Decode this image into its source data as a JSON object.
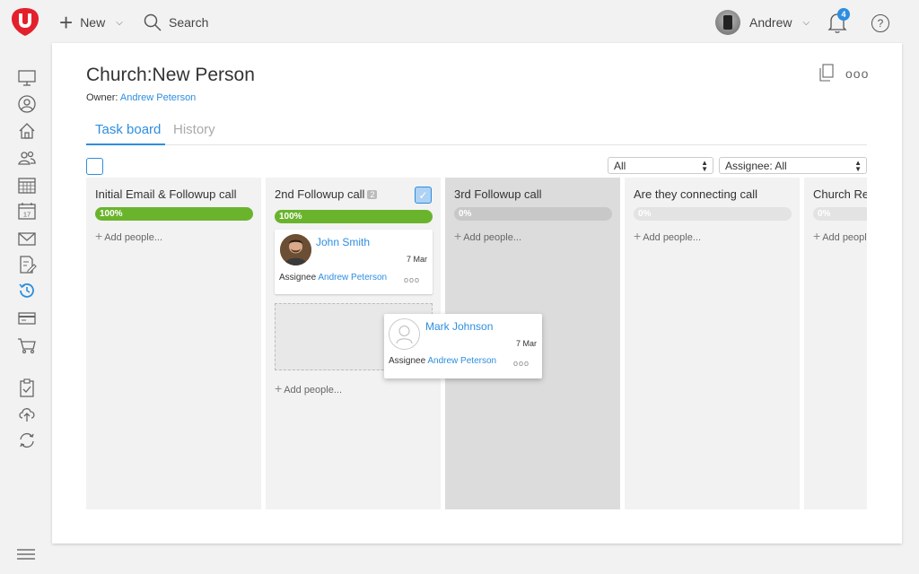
{
  "topbar": {
    "new_label": "New",
    "search_label": "Search",
    "user_name": "Andrew",
    "notification_count": "4",
    "help_label": "?"
  },
  "sidebar": {
    "icons": [
      "monitor-icon",
      "user-circle-icon",
      "home-icon",
      "people-icon",
      "calendar-grid-icon",
      "calendar-day-icon",
      "mail-icon",
      "form-icon",
      "history-icon",
      "credit-card-icon",
      "cart-icon",
      "clipboard-icon",
      "upload-cloud-icon",
      "sync-icon"
    ],
    "calendar_day": "17"
  },
  "page": {
    "title": "Church:New Person",
    "owner_label": "Owner:",
    "owner_name": "Andrew Peterson",
    "more_label": "ooo"
  },
  "tabs": [
    {
      "label": "Task board",
      "active": true
    },
    {
      "label": "History",
      "active": false
    }
  ],
  "filters": {
    "status": "All",
    "assignee": "Assignee: All"
  },
  "board": {
    "add_people_label": "Add people...",
    "columns": [
      {
        "title": "Initial Email & Followup call",
        "progress": "100%",
        "progress_value": 100
      },
      {
        "title": "2nd Followup call",
        "count": "2",
        "progress": "100%",
        "progress_value": 100
      },
      {
        "title": "3rd Followup call",
        "progress": "0%",
        "progress_value": 0
      },
      {
        "title": "Are they connecting call",
        "progress": "0%",
        "progress_value": 0
      },
      {
        "title": "Church Re",
        "progress": "0%",
        "progress_value": 0
      }
    ],
    "cards": [
      {
        "name": "John Smith",
        "date": "7 Mar",
        "assignee_label": "Assignee",
        "assignee": "Andrew Peterson",
        "more": "ooo"
      },
      {
        "name": "Mark Johnson",
        "date": "7 Mar",
        "assignee_label": "Assignee",
        "assignee": "Andrew Peterson",
        "more": "ooo"
      }
    ]
  },
  "colors": {
    "accent": "#2d8ee0",
    "logo": "#e3202b",
    "progress_done": "#6ab42d",
    "progress_empty": "#e3e3e3"
  }
}
